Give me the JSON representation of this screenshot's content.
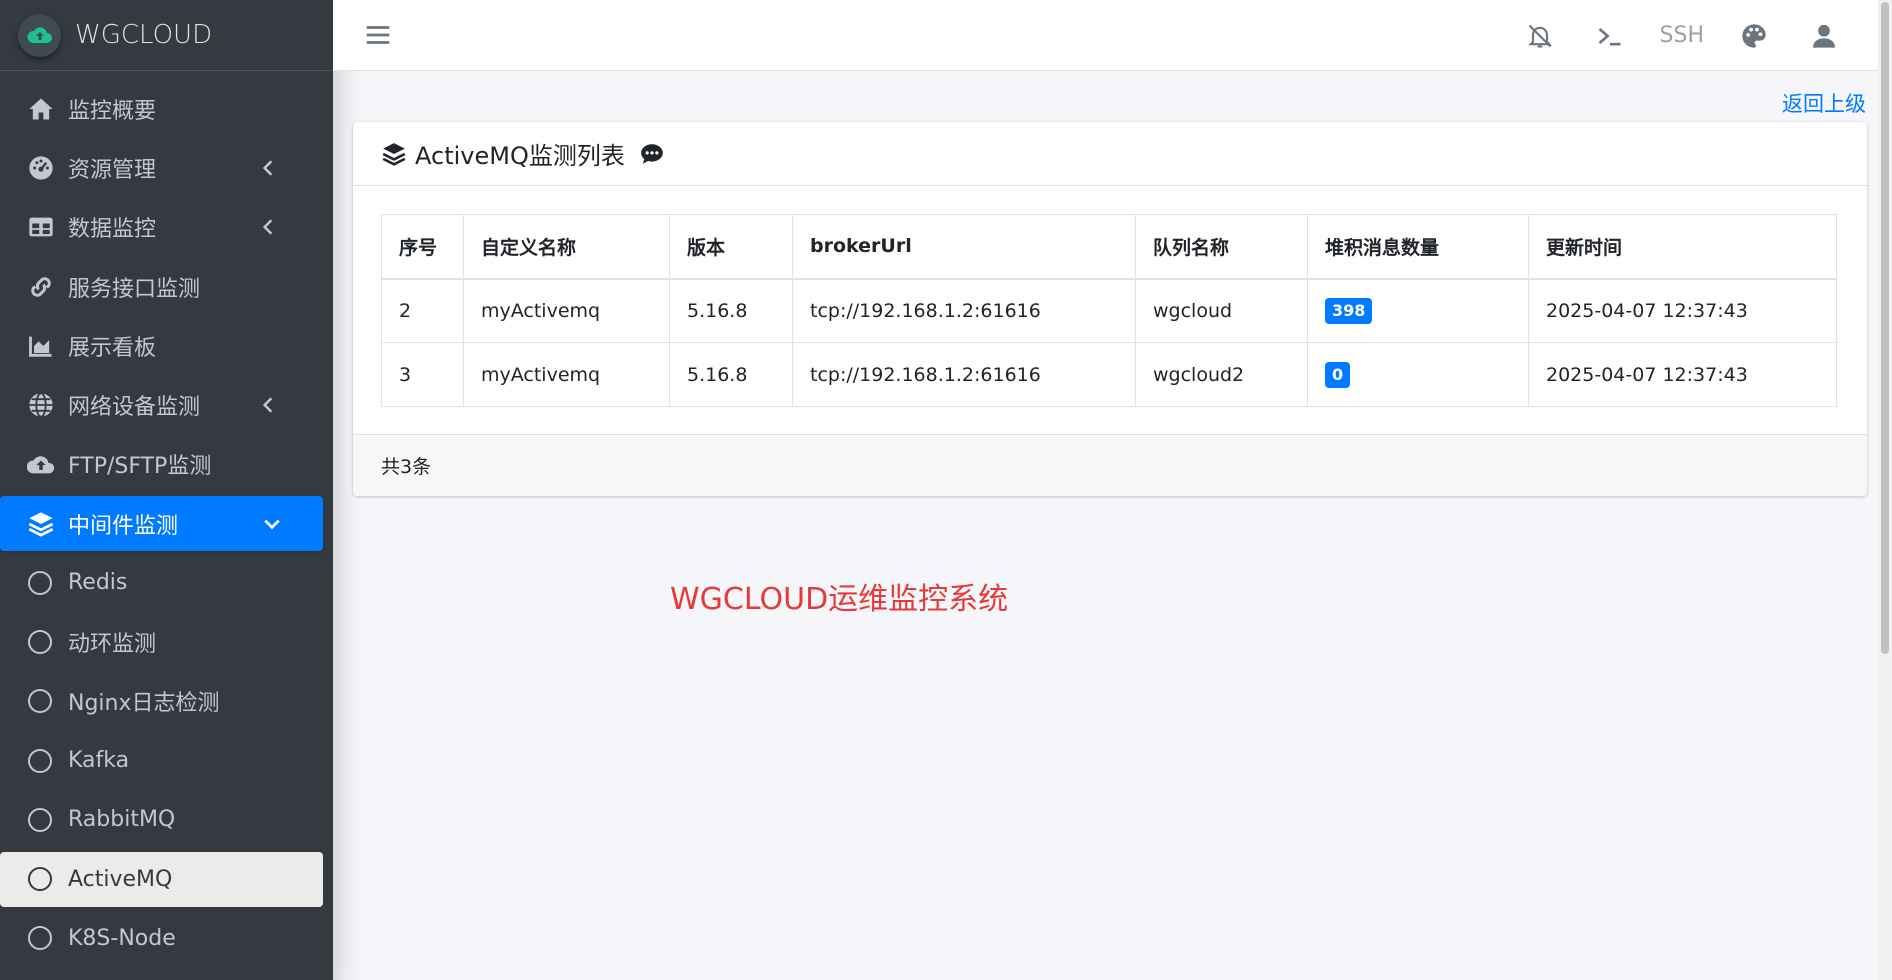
{
  "brand": {
    "name": "WGCLOUD"
  },
  "sidebar": {
    "items": [
      {
        "label": "监控概要",
        "icon": "home-icon"
      },
      {
        "label": "资源管理",
        "icon": "dashboard-icon"
      },
      {
        "label": "数据监控",
        "icon": "table-icon"
      },
      {
        "label": "服务接口监测",
        "icon": "link-icon"
      },
      {
        "label": "展示看板",
        "icon": "area-chart-icon"
      },
      {
        "label": "网络设备监测",
        "icon": "globe-icon"
      },
      {
        "label": "FTP/SFTP监测",
        "icon": "cloud-upload-icon"
      },
      {
        "label": "中间件监测",
        "icon": "layers-icon"
      }
    ],
    "subitems": [
      {
        "label": "Redis"
      },
      {
        "label": "动环监测"
      },
      {
        "label": "Nginx日志检测"
      },
      {
        "label": "Kafka"
      },
      {
        "label": "RabbitMQ"
      },
      {
        "label": "ActiveMQ"
      },
      {
        "label": "K8S-Node"
      }
    ]
  },
  "header": {
    "ssh_label": "SSH"
  },
  "back_link": "返回上级",
  "card": {
    "title": "ActiveMQ监测列表",
    "columns": [
      "序号",
      "自定义名称",
      "版本",
      "brokerUrl",
      "队列名称",
      "堆积消息数量",
      "更新时间"
    ],
    "rows": [
      {
        "id": "2",
        "name": "myActivemq",
        "version": "5.16.8",
        "broker": "tcp://192.168.1.2:61616",
        "queue": "wgcloud",
        "pending": "398",
        "updated": "2025-04-07 12:37:43"
      },
      {
        "id": "3",
        "name": "myActivemq",
        "version": "5.16.8",
        "broker": "tcp://192.168.1.2:61616",
        "queue": "wgcloud2",
        "pending": "0",
        "updated": "2025-04-07 12:37:43"
      }
    ],
    "footer": "共3条"
  },
  "watermark": "WGCLOUD运维监控系统",
  "colors": {
    "primary": "#007bff",
    "sidebar": "#343a40",
    "watermark": "#e63a3a"
  }
}
